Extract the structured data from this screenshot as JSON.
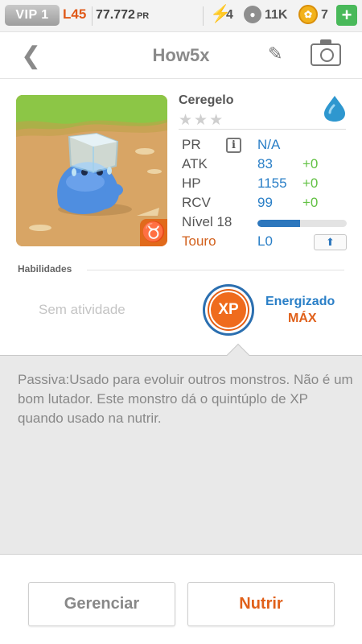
{
  "status_bar": {
    "vip": "VIP 1",
    "level": "L45",
    "power": "77.772",
    "power_unit": "PR",
    "energy": "4",
    "food": "11K",
    "coins": "7"
  },
  "header": {
    "title": "How5x"
  },
  "monster": {
    "name": "Ceregelo",
    "rarity_stars": "★★★",
    "element_icon": "water-drop-icon",
    "zodiac_symbol": "♉",
    "stats": [
      {
        "label": "PR",
        "value": "N/A",
        "bonus": ""
      },
      {
        "label": "ATK",
        "value": "83",
        "bonus": "+0"
      },
      {
        "label": "HP",
        "value": "1155",
        "bonus": "+0"
      },
      {
        "label": "RCV",
        "value": "99",
        "bonus": "+0"
      }
    ],
    "level_label": "Nível 18",
    "level_progress": 0.48,
    "zodiac_label": "Touro",
    "zodiac_level": "L0"
  },
  "abilities": {
    "title": "Habilidades",
    "none_text": "Sem atividade",
    "xp_badge": "XP",
    "status": "Energizado",
    "status_level": "MÁX"
  },
  "description": "Passiva:Usado para evoluir outros monstros. Não é um bom lutador. Este monstro dá o quintúplo de XP quando usado na nutrir.",
  "actions": {
    "manage": "Gerenciar",
    "feed": "Nutrir"
  },
  "colors": {
    "accent_blue": "#2a7fc7",
    "accent_orange": "#e0601a",
    "bonus_green": "#62c144"
  }
}
